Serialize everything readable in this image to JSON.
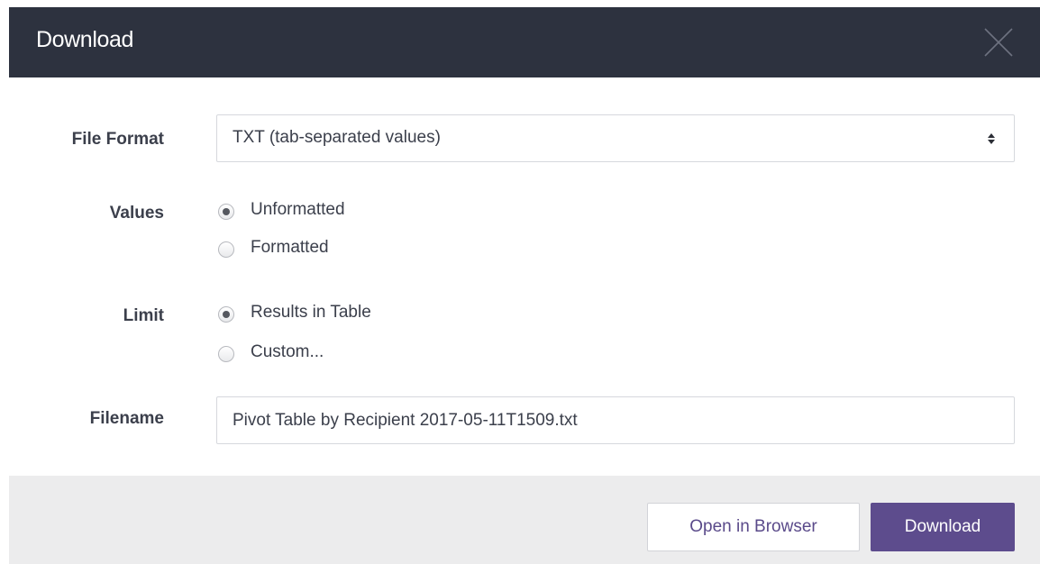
{
  "dialog": {
    "title": "Download"
  },
  "form": {
    "file_format": {
      "label": "File Format",
      "selected": "TXT (tab-separated values)"
    },
    "values": {
      "label": "Values",
      "options": [
        {
          "label": "Unformatted",
          "selected": true
        },
        {
          "label": "Formatted",
          "selected": false
        }
      ]
    },
    "limit": {
      "label": "Limit",
      "options": [
        {
          "label": "Results in Table",
          "selected": true
        },
        {
          "label": "Custom...",
          "selected": false
        }
      ]
    },
    "filename": {
      "label": "Filename",
      "value": "Pivot Table by Recipient 2017-05-11T1509.txt"
    }
  },
  "footer": {
    "open_in_browser_label": "Open in Browser",
    "download_label": "Download"
  },
  "colors": {
    "header_bg": "#2d323f",
    "primary_button": "#5d4c8d",
    "footer_bg": "#ececed"
  },
  "icons": {
    "close": "close-icon",
    "select_arrows": "select-arrows-icon"
  }
}
